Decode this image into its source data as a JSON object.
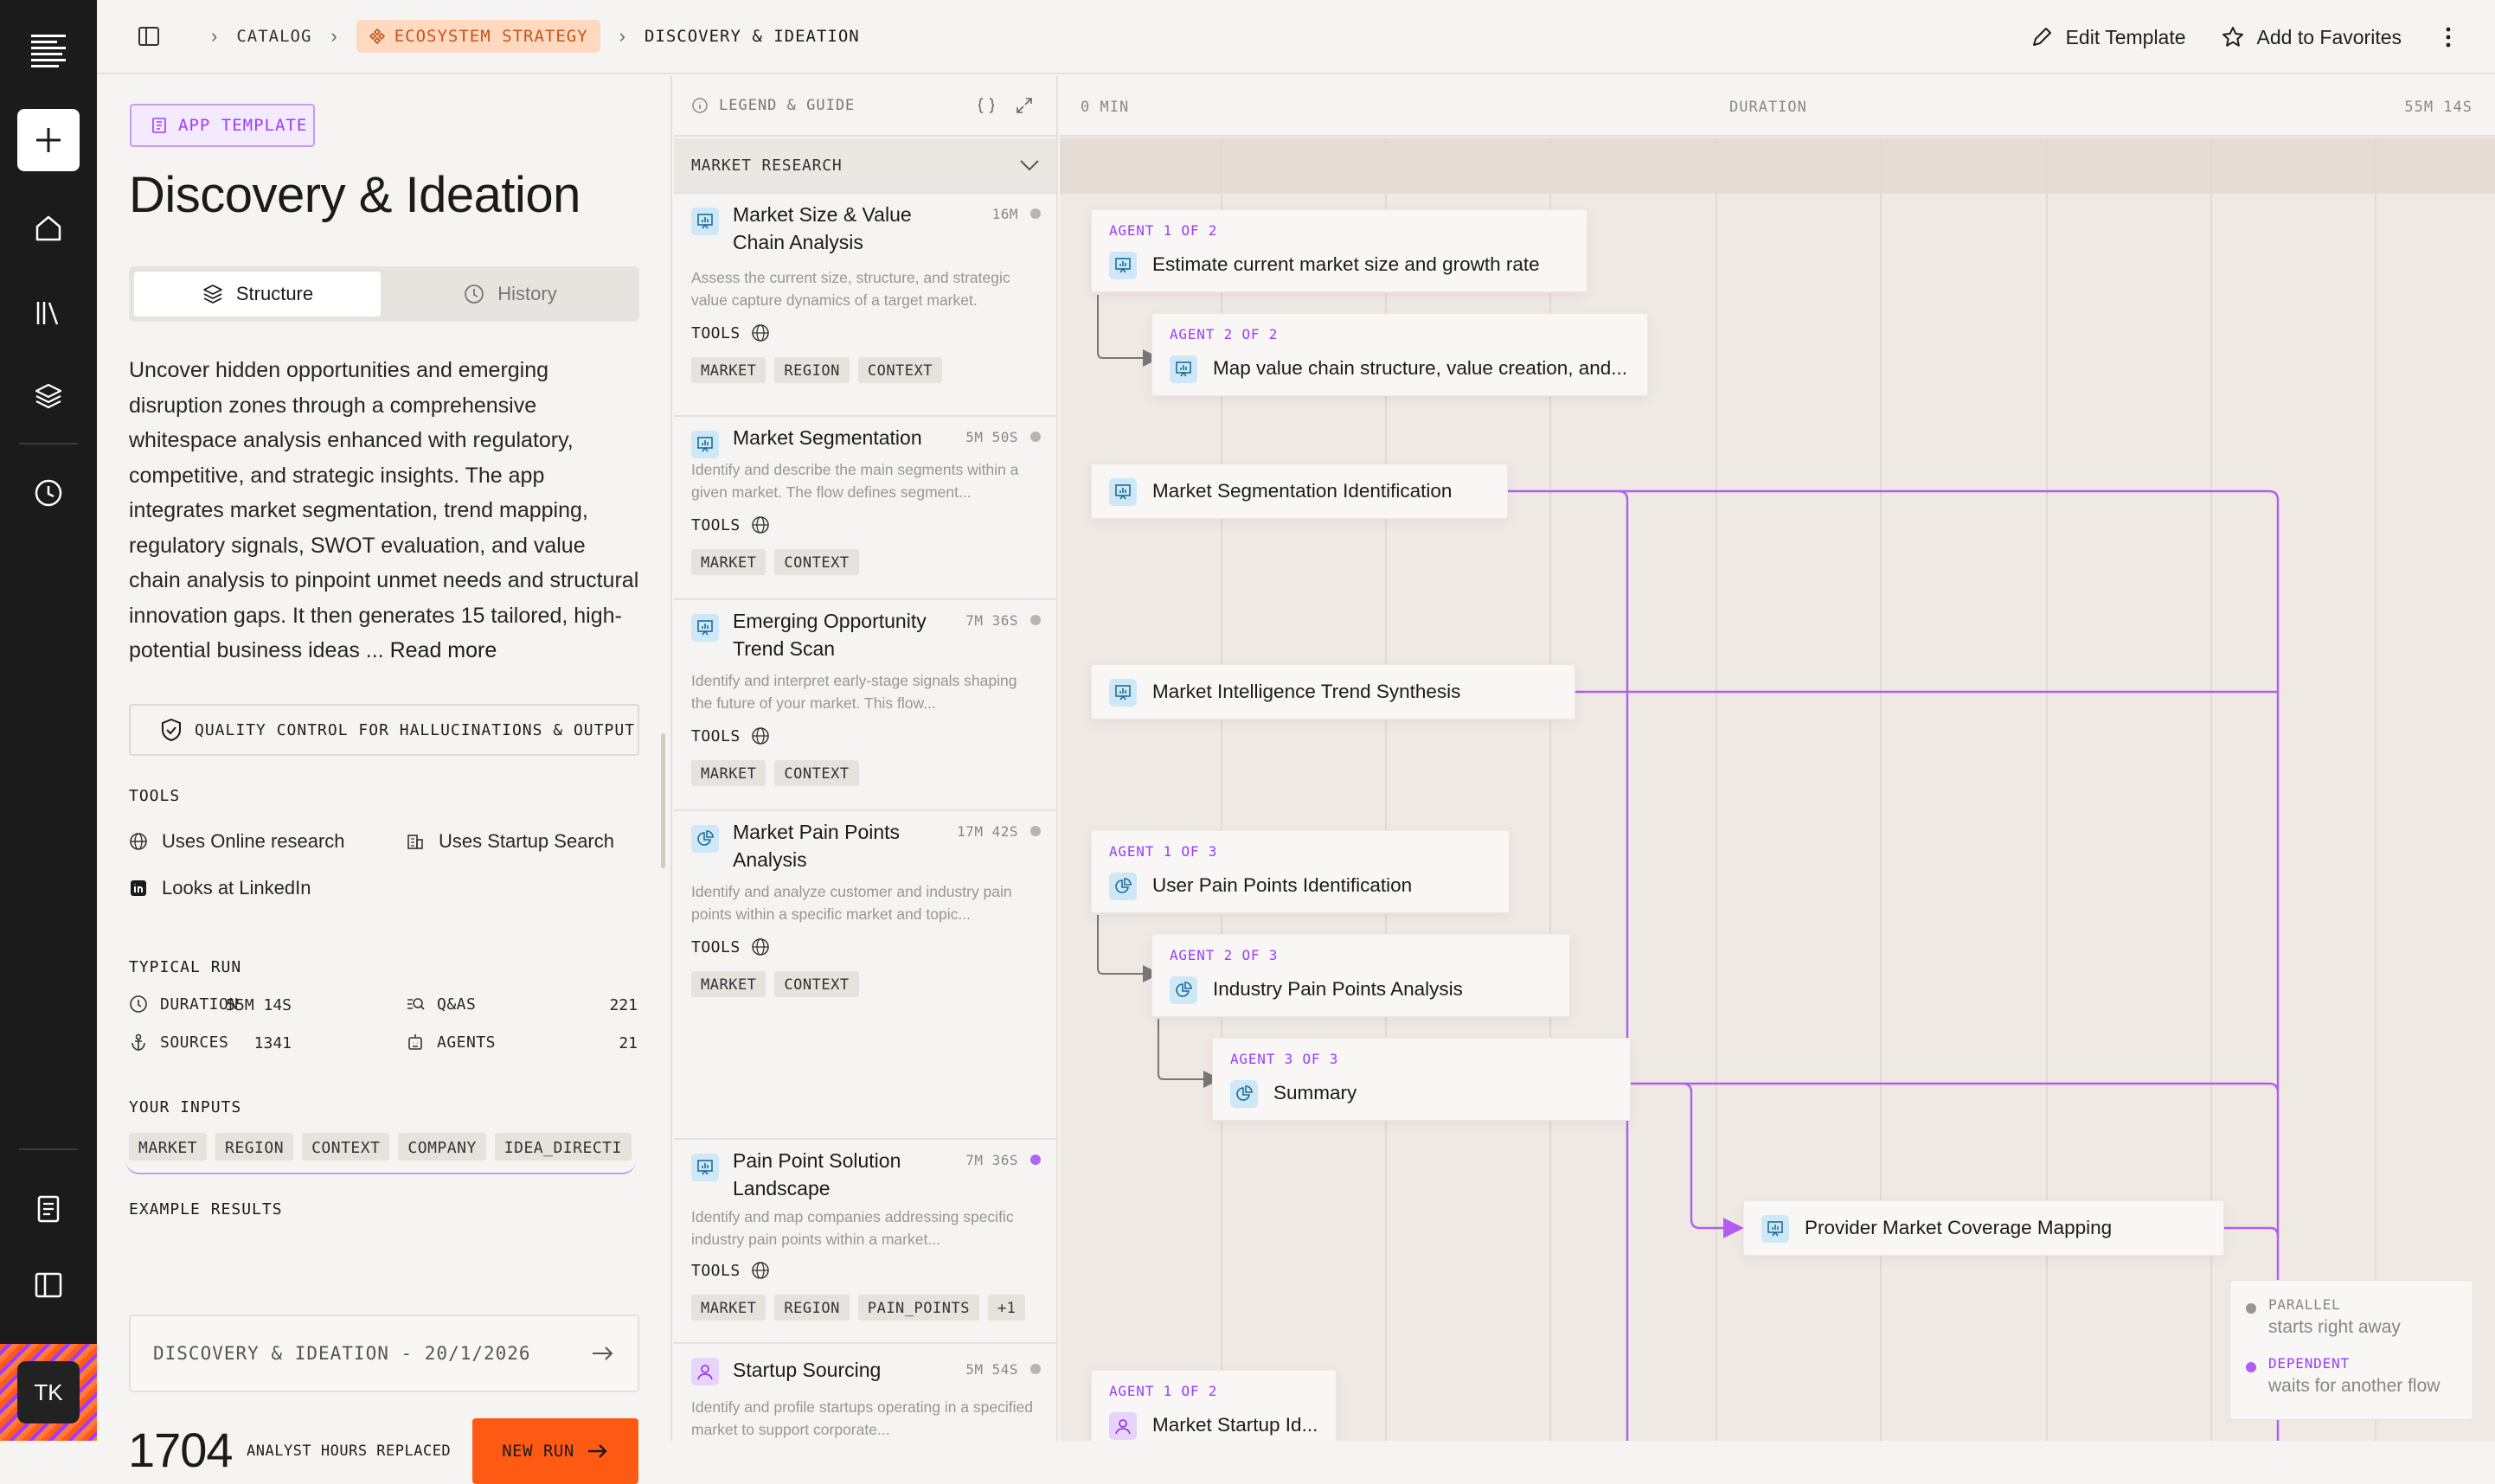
{
  "rail": {
    "avatar": "TK",
    "icons": [
      "menu-logo-icon",
      "plus-icon",
      "home-icon",
      "library-icon",
      "layers-icon",
      "clock-icon",
      "notes-icon",
      "panel-icon"
    ]
  },
  "breadcrumb": {
    "items": [
      "CATALOG",
      "ECOSYSTEM STRATEGY",
      "DISCOVERY & IDEATION"
    ]
  },
  "topbar": {
    "edit_label": "Edit Template",
    "favorites_label": "Add to Favorites"
  },
  "left": {
    "badge": "APP TEMPLATE",
    "title": "Discovery & Ideation",
    "tabs": [
      {
        "label": "Structure",
        "active": true
      },
      {
        "label": "History",
        "active": false
      }
    ],
    "description": "Uncover hidden opportunities and emerging disruption zones through a comprehensive whitespace analysis enhanced with regulatory, competitive, and strategic insights. The app integrates market segmentation, trend mapping, regulatory signals, SWOT evaluation, and value chain analysis to pinpoint unmet needs and structural innovation gaps. It then generates 15 tailored, high-potential business ideas ...",
    "read_more": "Read more",
    "qc_label": "QUALITY CONTROL FOR HALLUCINATIONS & OUTPUT",
    "tools_heading": "TOOLS",
    "tools": [
      "Uses Online research",
      "Uses Startup Search",
      "Looks at LinkedIn"
    ],
    "typical_heading": "TYPICAL RUN",
    "stats": [
      {
        "label": "DURATION",
        "value": "55M 14S"
      },
      {
        "label": "Q&AS",
        "value": "221"
      },
      {
        "label": "SOURCES",
        "value": "1341"
      },
      {
        "label": "AGENTS",
        "value": "21"
      }
    ],
    "inputs_heading": "YOUR INPUTS",
    "inputs": [
      "MARKET",
      "REGION",
      "CONTEXT",
      "COMPANY",
      "IDEA_DIRECTI"
    ],
    "examples_heading": "EXAMPLE RESULTS",
    "example": "DISCOVERY & IDEATION - 20/1/2026",
    "hours_value": "1704",
    "hours_label": "ANALYST HOURS REPLACED",
    "new_run": "NEW RUN"
  },
  "mid": {
    "legend_label": "LEGEND & GUIDE",
    "group": "MARKET RESEARCH",
    "tools_label": "TOOLS",
    "cards": [
      {
        "title": "Market Size & Value Chain Analysis",
        "duration": "16M",
        "desc": "Assess the current size, structure, and strategic value capture dynamics of a target market.",
        "chips": [
          "MARKET",
          "REGION",
          "CONTEXT"
        ],
        "dot": "grey",
        "icon": "presentation-chart-icon"
      },
      {
        "title": "Market Segmentation",
        "duration": "5M 50S",
        "desc": "Identify and describe the main segments within a given market. The flow defines segment...",
        "chips": [
          "MARKET",
          "CONTEXT"
        ],
        "dot": "grey",
        "icon": "presentation-chart-icon"
      },
      {
        "title": "Emerging Opportunity Trend Scan",
        "duration": "7M 36S",
        "desc": "Identify and interpret early-stage signals shaping the future of your market. This flow...",
        "chips": [
          "MARKET",
          "CONTEXT"
        ],
        "dot": "grey",
        "icon": "presentation-chart-icon"
      },
      {
        "title": "Market Pain Points Analysis",
        "duration": "17M 42S",
        "desc": "Identify and analyze customer and industry pain points within a specific market and topic...",
        "chips": [
          "MARKET",
          "CONTEXT"
        ],
        "dot": "grey",
        "icon": "pie-chart-icon"
      },
      {
        "title": "Pain Point Solution Landscape",
        "duration": "7M 36S",
        "desc": "Identify and map companies addressing specific industry pain points within a market...",
        "chips": [
          "MARKET",
          "REGION",
          "PAIN_POINTS",
          "+1"
        ],
        "dot": "purple",
        "icon": "presentation-chart-icon"
      },
      {
        "title": "Startup Sourcing",
        "duration": "5M 54S",
        "desc": "Identify and profile startups operating in a specified market to support corporate...",
        "chips": [],
        "dot": "grey",
        "icon": "user-icon"
      }
    ]
  },
  "timeline": {
    "start": "0 MIN",
    "center": "DURATION",
    "end": "55M 14S",
    "nodes": [
      {
        "agent": "AGENT 1 OF 2",
        "label": "Estimate current market size and growth rate"
      },
      {
        "agent": "AGENT 2 OF 2",
        "label": "Map value chain structure, value creation, and..."
      },
      {
        "agent": "",
        "label": "Market Segmentation Identification"
      },
      {
        "agent": "",
        "label": "Market Intelligence Trend Synthesis"
      },
      {
        "agent": "AGENT 1 OF 3",
        "label": "User Pain Points Identification"
      },
      {
        "agent": "AGENT 2 OF 3",
        "label": "Industry Pain Points Analysis"
      },
      {
        "agent": "AGENT 3 OF 3",
        "label": "Summary"
      },
      {
        "agent": "",
        "label": "Provider Market Coverage Mapping"
      },
      {
        "agent": "AGENT 1 OF 2",
        "label": "Market Startup Id..."
      }
    ],
    "legend": {
      "parallel_key": "PARALLEL",
      "parallel_desc": "starts right away",
      "dependent_key": "DEPENDENT",
      "dependent_desc": "waits for another flow"
    },
    "colors": {
      "accent": "#9b3cff",
      "connector": "#b35cf2",
      "orange": "#ff5a14"
    }
  }
}
